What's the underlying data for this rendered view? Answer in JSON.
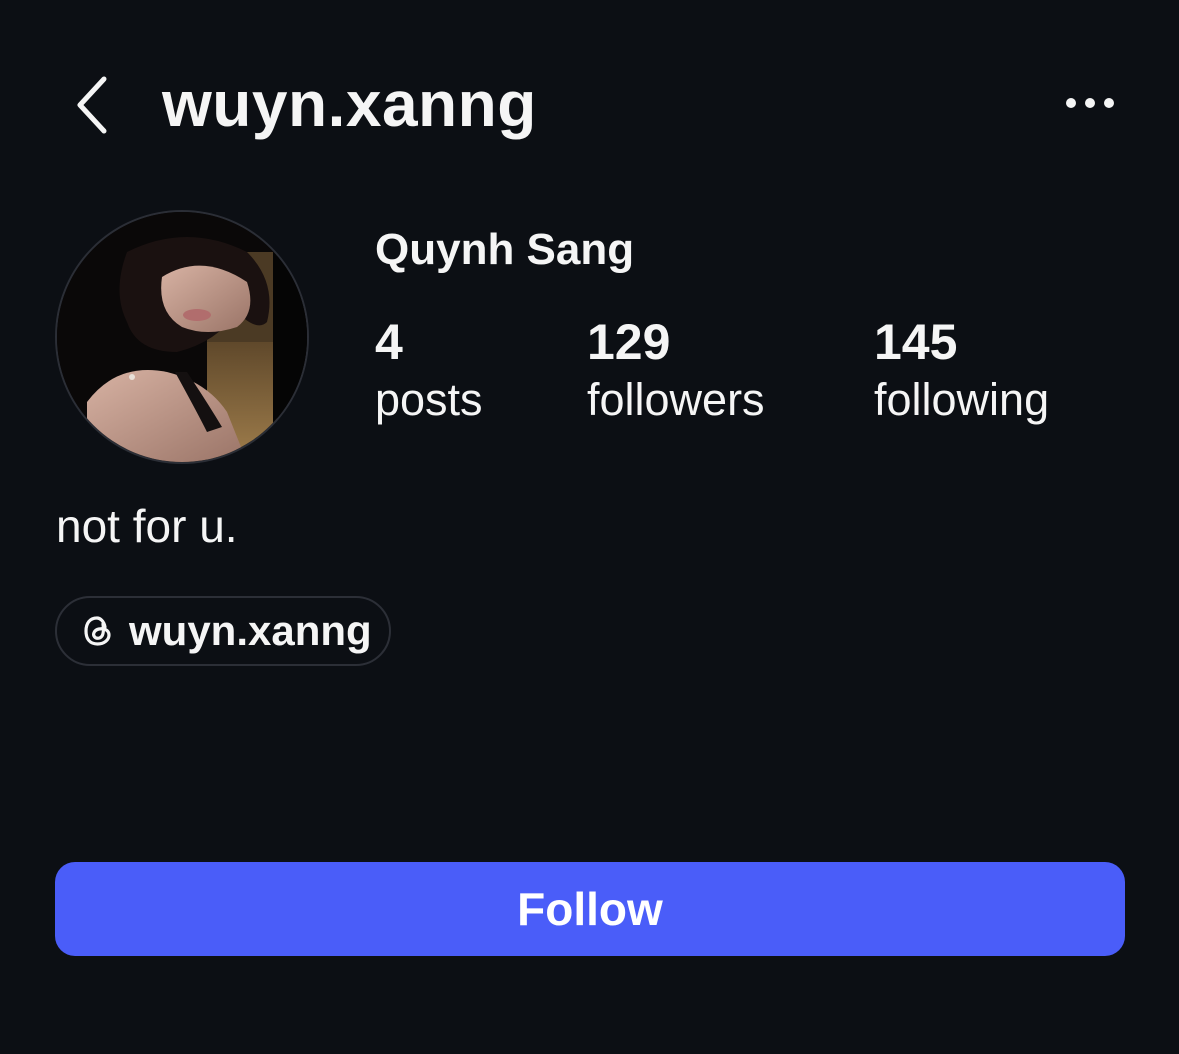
{
  "header": {
    "username": "wuyn.xanng",
    "back_icon": "chevron-left-icon",
    "more_icon": "ellipsis-horizontal-icon"
  },
  "profile": {
    "display_name": "Quynh Sang",
    "avatar": "profile-photo",
    "stats": [
      {
        "value": "4",
        "label": "posts"
      },
      {
        "value": "129",
        "label": "followers"
      },
      {
        "value": "145",
        "label": "following"
      }
    ],
    "bio": "not for u.",
    "threads_link": {
      "icon": "threads-icon",
      "label": "wuyn.xanng"
    }
  },
  "actions": {
    "follow_label": "Follow"
  },
  "colors": {
    "background": "#0c0f14",
    "text": "#f5f5f5",
    "follow_button": "#4a5df9",
    "pill_border": "#2c2f37"
  }
}
